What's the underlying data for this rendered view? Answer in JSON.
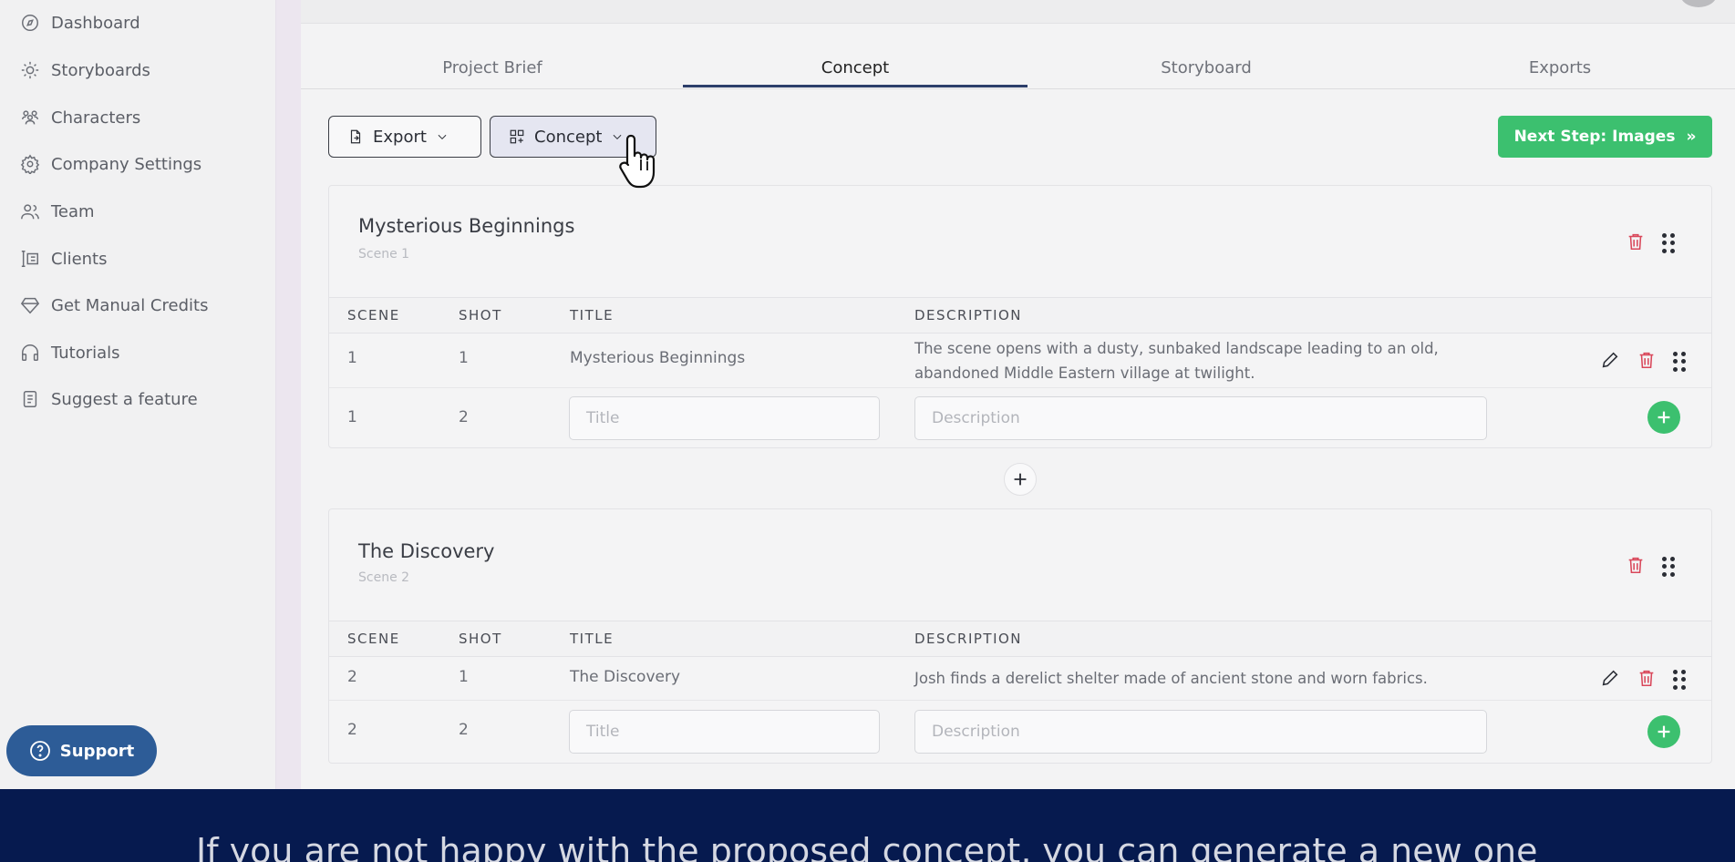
{
  "sidebar": {
    "items": [
      {
        "label": "Dashboard",
        "icon": "compass-icon"
      },
      {
        "label": "Storyboards",
        "icon": "sun-icon"
      },
      {
        "label": "Characters",
        "icon": "users-icon"
      },
      {
        "label": "Company Settings",
        "icon": "gear-icon"
      },
      {
        "label": "Team",
        "icon": "team-icon"
      },
      {
        "label": "Clients",
        "icon": "clients-icon"
      },
      {
        "label": "Get Manual Credits",
        "icon": "diamond-icon"
      },
      {
        "label": "Tutorials",
        "icon": "headphones-icon"
      },
      {
        "label": "Suggest a feature",
        "icon": "document-icon"
      }
    ],
    "support_label": "Support"
  },
  "tabs": [
    "Project Brief",
    "Concept",
    "Storyboard",
    "Exports"
  ],
  "active_tab": "Concept",
  "toolbar": {
    "export_label": "Export",
    "concept_label": "Concept",
    "next_label": "Next Step: Images"
  },
  "table_headers": {
    "scene": "SCENE",
    "shot": "SHOT",
    "title": "TITLE",
    "description": "DESCRIPTION"
  },
  "scenes": [
    {
      "title": "Mysterious Beginnings",
      "subtitle": "Scene 1",
      "rows": [
        {
          "scene": "1",
          "shot": "1",
          "title": "Mysterious Beginnings",
          "description": "The scene opens with a dusty, sunbaked landscape leading to an old, abandoned Middle Eastern village at twilight."
        }
      ],
      "new_row": {
        "scene": "1",
        "shot": "2",
        "title_placeholder": "Title",
        "description_placeholder": "Description"
      }
    },
    {
      "title": "The Discovery",
      "subtitle": "Scene 2",
      "rows": [
        {
          "scene": "2",
          "shot": "1",
          "title": "The Discovery",
          "description": "Josh finds a derelict shelter made of ancient stone and worn fabrics."
        }
      ],
      "new_row": {
        "scene": "2",
        "shot": "2",
        "title_placeholder": "Title",
        "description_placeholder": "Description"
      }
    }
  ],
  "caption": "If you are not happy with the proposed concept, you can generate a new one",
  "colors": {
    "accent_green": "#3cc06f",
    "support_blue": "#2d5c97",
    "danger_red": "#d9475a",
    "caption_bg": "#061a4f"
  }
}
